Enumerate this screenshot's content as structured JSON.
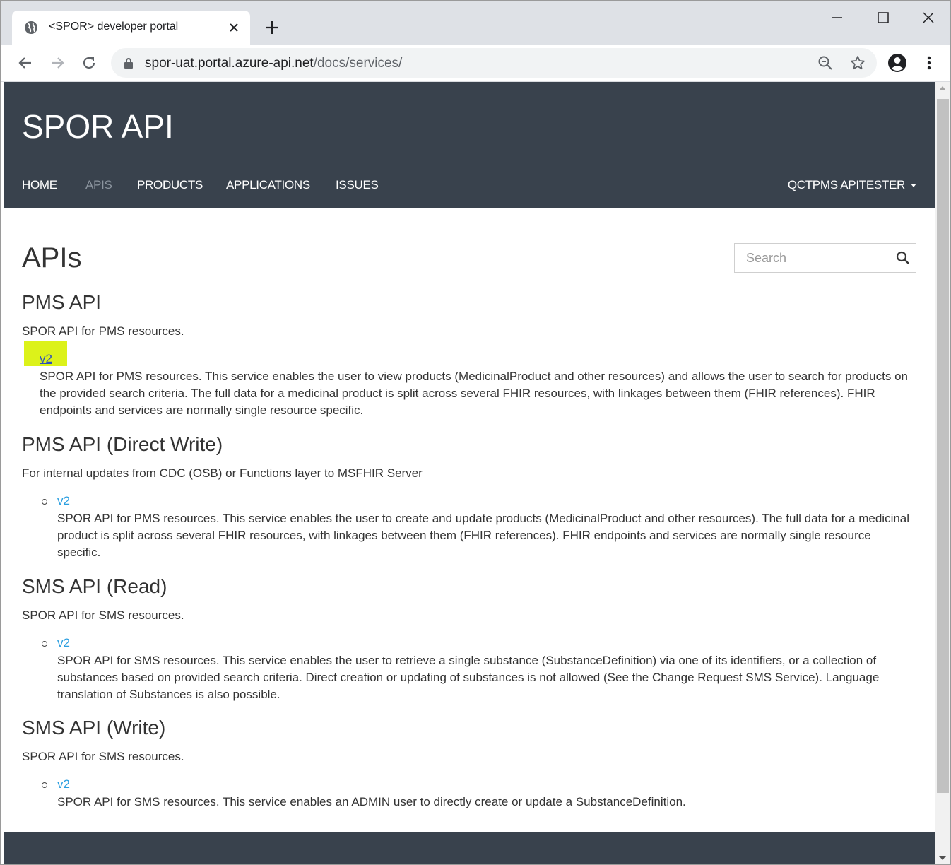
{
  "browser": {
    "tab_title": "<SPOR> developer portal",
    "url_host": "spor-uat.portal.azure-api.net",
    "url_path": "/docs/services/"
  },
  "header": {
    "brand": "SPOR API",
    "nav": [
      {
        "label": "HOME",
        "active": false
      },
      {
        "label": "APIS",
        "active": true
      },
      {
        "label": "PRODUCTS",
        "active": false
      },
      {
        "label": "APPLICATIONS",
        "active": false
      },
      {
        "label": "ISSUES",
        "active": false
      }
    ],
    "user_menu": "QCTPMS APITESTER"
  },
  "page": {
    "title": "APIs",
    "search_placeholder": "Search"
  },
  "apis": [
    {
      "name": "PMS API",
      "description": "SPOR API for PMS resources.",
      "version": "v2",
      "version_description": "SPOR API for PMS resources. This service enables the user to view products (MedicinalProduct and other resources) and allows the user to search for products on the provided search criteria. The full data for a medicinal product is split across several FHIR resources, with linkages between them (FHIR references). FHIR endpoints and services are normally single resource specific."
    },
    {
      "name": "PMS API (Direct Write)",
      "description": "For internal updates from CDC (OSB) or Functions layer to MSFHIR Server",
      "version": "v2",
      "version_description": "SPOR API for PMS resources. This service enables the user to create and update products (MedicinalProduct and other resources). The full data for a medicinal product is split across several FHIR resources, with linkages between them (FHIR references). FHIR endpoints and services are normally single resource specific."
    },
    {
      "name": "SMS API (Read)",
      "description": "SPOR API for SMS resources.",
      "version": "v2",
      "version_description": "SPOR API for SMS resources. This service enables the user to retrieve a single substance (SubstanceDefinition) via one of its identifiers, or a collection of substances based on provided search criteria. Direct creation or updating of substances is not allowed (See the Change Request SMS Service). Language translation of Substances is also possible."
    },
    {
      "name": "SMS API (Write)",
      "description": "SPOR API for SMS resources.",
      "version": "v2",
      "version_description": "SPOR API for SMS resources. This service enables an ADMIN user to directly create or update a SubstanceDefinition."
    }
  ],
  "colors": {
    "header_bg": "#39424d",
    "link": "#2c9fe0",
    "highlight": "#dcf21a"
  }
}
